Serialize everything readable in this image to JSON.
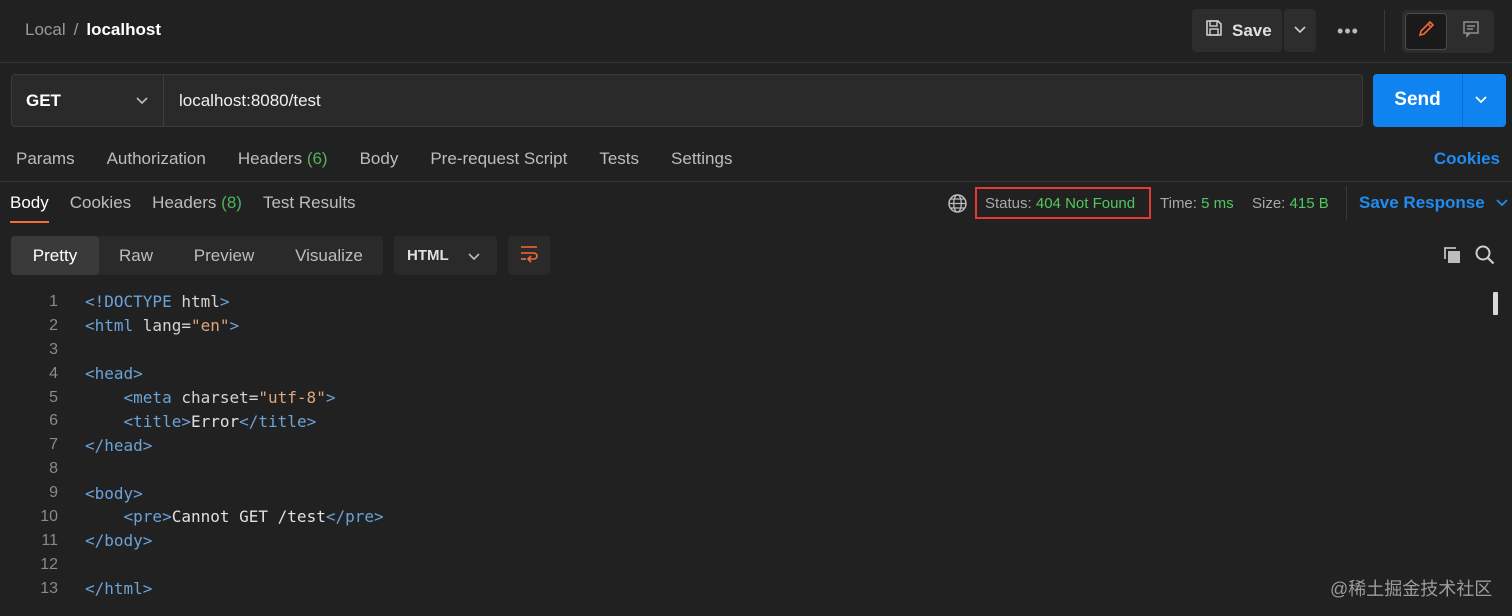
{
  "breadcrumb": {
    "parent": "Local",
    "separator": "/",
    "current": "localhost"
  },
  "toolbar": {
    "save_label": "Save",
    "more_label": "•••"
  },
  "request": {
    "method": "GET",
    "url": "localhost:8080/test",
    "send_label": "Send"
  },
  "request_tabs": [
    {
      "label": "Params"
    },
    {
      "label": "Authorization"
    },
    {
      "label": "Headers",
      "count": "(6)"
    },
    {
      "label": "Body"
    },
    {
      "label": "Pre-request Script"
    },
    {
      "label": "Tests"
    },
    {
      "label": "Settings"
    }
  ],
  "cookies_link": "Cookies",
  "response_tabs": [
    {
      "label": "Body",
      "active": true
    },
    {
      "label": "Cookies"
    },
    {
      "label": "Headers",
      "count": "(8)"
    },
    {
      "label": "Test Results"
    }
  ],
  "response_meta": {
    "status_label": "Status:",
    "status_value": "404 Not Found",
    "time_label": "Time:",
    "time_value": "5 ms",
    "size_label": "Size:",
    "size_value": "415 B",
    "save_response_label": "Save Response"
  },
  "format_options": [
    {
      "label": "Pretty",
      "active": true
    },
    {
      "label": "Raw"
    },
    {
      "label": "Preview"
    },
    {
      "label": "Visualize"
    }
  ],
  "language": "HTML",
  "code_lines": [
    {
      "n": "1",
      "segs": [
        [
          "doctype",
          "<!DOCTYPE "
        ],
        [
          "attr",
          "html"
        ],
        [
          "doctype",
          ">"
        ]
      ]
    },
    {
      "n": "2",
      "segs": [
        [
          "tag",
          "<html "
        ],
        [
          "attr",
          "lang="
        ],
        [
          "str",
          "\"en\""
        ],
        [
          "tag",
          ">"
        ]
      ]
    },
    {
      "n": "3",
      "segs": []
    },
    {
      "n": "4",
      "segs": [
        [
          "tag",
          "<head>"
        ]
      ]
    },
    {
      "n": "5",
      "segs": [
        [
          "text",
          "    "
        ],
        [
          "tag",
          "<meta "
        ],
        [
          "attr",
          "charset="
        ],
        [
          "str",
          "\"utf-8\""
        ],
        [
          "tag",
          ">"
        ]
      ]
    },
    {
      "n": "6",
      "segs": [
        [
          "text",
          "    "
        ],
        [
          "tag",
          "<title>"
        ],
        [
          "text",
          "Error"
        ],
        [
          "tag",
          "</title>"
        ]
      ]
    },
    {
      "n": "7",
      "segs": [
        [
          "tag",
          "</head>"
        ]
      ]
    },
    {
      "n": "8",
      "segs": []
    },
    {
      "n": "9",
      "segs": [
        [
          "tag",
          "<body>"
        ]
      ]
    },
    {
      "n": "10",
      "segs": [
        [
          "text",
          "    "
        ],
        [
          "tag",
          "<pre>"
        ],
        [
          "text",
          "Cannot GET /test"
        ],
        [
          "tag",
          "</pre>"
        ]
      ]
    },
    {
      "n": "11",
      "segs": [
        [
          "tag",
          "</body>"
        ]
      ]
    },
    {
      "n": "12",
      "segs": []
    },
    {
      "n": "13",
      "segs": [
        [
          "tag",
          "</html>"
        ]
      ]
    }
  ],
  "watermark": "@稀土掘金技术社区",
  "colors": {
    "accent": "#0f84f0",
    "status_green": "#52c75d",
    "highlight_box": "#e53935",
    "active_tab_underline": "#f26b3a"
  }
}
